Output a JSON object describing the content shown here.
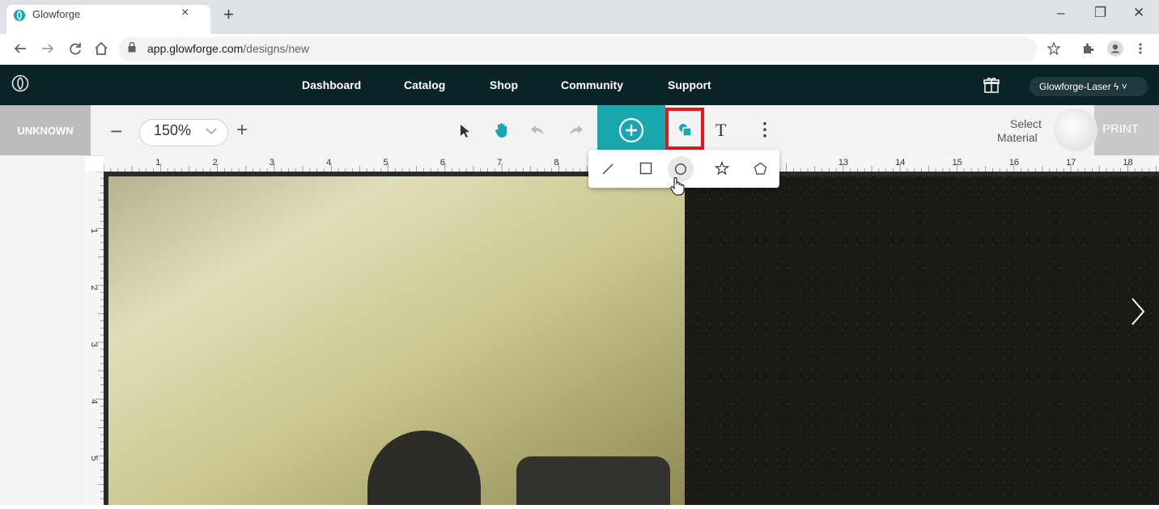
{
  "browser": {
    "tab_title": "Glowforge",
    "tab_close": "×",
    "new_tab": "+",
    "url_host": "app.glowforge.com",
    "url_path": "/designs/new",
    "window_controls": [
      "–",
      "❐",
      "✕"
    ],
    "nav_icons": [
      "back-arrow-icon",
      "forward-arrow-icon",
      "reload-icon",
      "home-icon"
    ]
  },
  "appnav": {
    "links": [
      "Dashboard",
      "Catalog",
      "Shop",
      "Community",
      "Support"
    ],
    "user_menu": "Glowforge-Laser ϟ ˅"
  },
  "toolbar": {
    "status": "UNKNOWN",
    "zoom_out": "−",
    "zoom_value": "150%",
    "zoom_in": "+",
    "text_tool": "T",
    "more": "⋮",
    "select_material_line1": "Select",
    "select_material_line2": "Material",
    "print_label": "PRINT"
  },
  "shape_popup": {
    "tools": [
      "line-tool",
      "rectangle-tool",
      "circle-tool",
      "star-tool",
      "pentagon-tool"
    ]
  },
  "rulers": {
    "top_labels": [
      "1",
      "2",
      "3",
      "4",
      "5",
      "6",
      "7",
      "8",
      "",
      "",
      "",
      "",
      "13",
      "14",
      "15",
      "16",
      "17",
      "18"
    ],
    "left_labels": [
      "1",
      "2",
      "3",
      "4",
      "5"
    ]
  },
  "colors": {
    "nav_bg": "#0a2327",
    "accent": "#19a6ae",
    "highlight": "#e8151b"
  }
}
